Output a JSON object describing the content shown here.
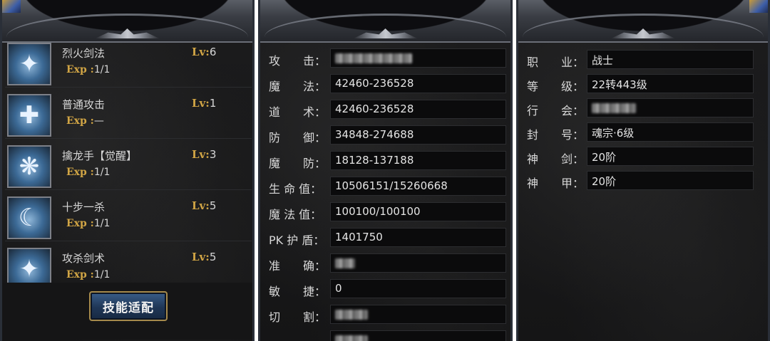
{
  "skills_panel": {
    "skills": [
      {
        "name": "烈火剑法",
        "lv_label": "Lv:",
        "lv": "6",
        "exp_label": "Exp :",
        "exp": "1/1"
      },
      {
        "name": "普通攻击",
        "lv_label": "Lv:",
        "lv": "1",
        "exp_label": "Exp :",
        "exp": "—"
      },
      {
        "name": "擒龙手【觉醒】",
        "lv_label": "Lv:",
        "lv": "3",
        "exp_label": "Exp :",
        "exp": "1/1"
      },
      {
        "name": "十步一杀",
        "lv_label": "Lv:",
        "lv": "5",
        "exp_label": "Exp :",
        "exp": "1/1"
      },
      {
        "name": "攻杀剑术",
        "lv_label": "Lv:",
        "lv": "5",
        "exp_label": "Exp :",
        "exp": "1/1"
      }
    ],
    "adapt_button": "技能适配"
  },
  "stats_panel": {
    "rows": [
      {
        "label": "攻　　击：",
        "value": ""
      },
      {
        "label": "魔　　法：",
        "value": "42460-236528"
      },
      {
        "label": "道　　术：",
        "value": "42460-236528"
      },
      {
        "label": "防　　御：",
        "value": "34848-274688"
      },
      {
        "label": "魔　　防：",
        "value": "18128-137188"
      },
      {
        "label": "生 命 值：",
        "value": "10506151/15260668"
      },
      {
        "label": "魔 法 值：",
        "value": "100100/100100"
      },
      {
        "label": "PK 护 盾：",
        "value": "1401750"
      },
      {
        "label": "准　　确：",
        "value": ""
      },
      {
        "label": "敏　　捷：",
        "value": "0"
      },
      {
        "label": "切　　割：",
        "value": ""
      }
    ]
  },
  "info_panel": {
    "rows": [
      {
        "label": "职　　业：",
        "value": "战士"
      },
      {
        "label": "等　　级：",
        "value": "22转443级"
      },
      {
        "label": "行　　会：",
        "value": ""
      },
      {
        "label": "封　　号：",
        "value": "魂宗·6级"
      },
      {
        "label": "神　　剑：",
        "value": "20阶"
      },
      {
        "label": "神　　甲：",
        "value": "20阶"
      }
    ]
  }
}
